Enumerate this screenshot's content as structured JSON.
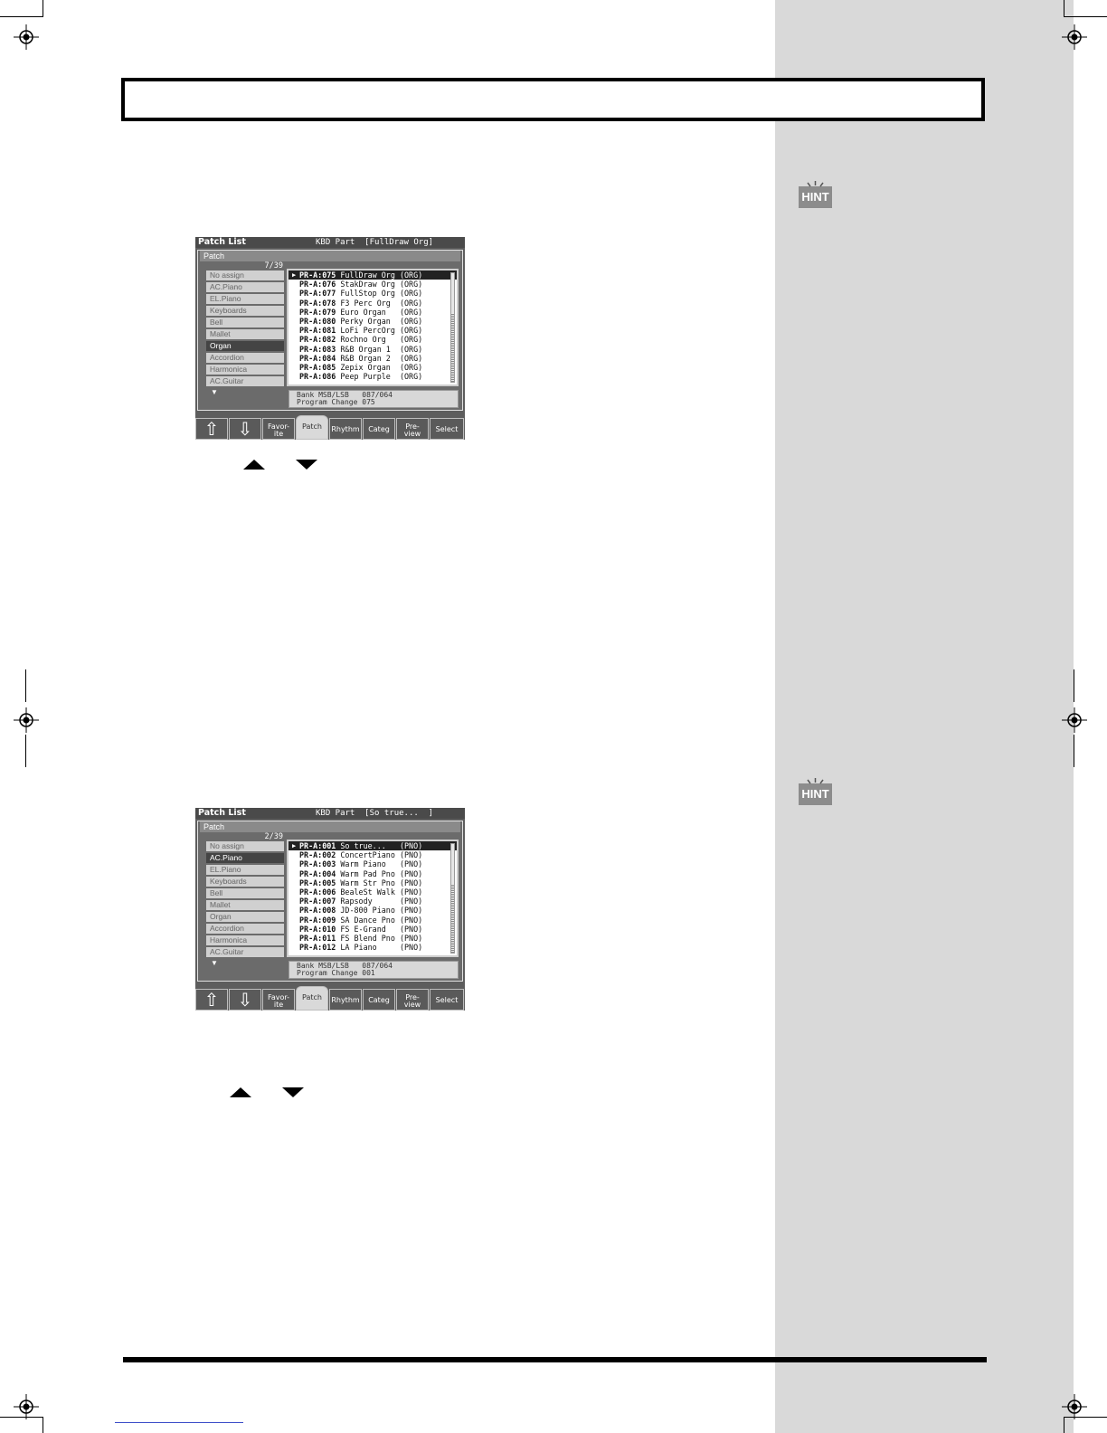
{
  "hint": {
    "label": "HINT"
  },
  "screens": [
    {
      "title": "Patch List",
      "part_label": "KBD Part  [FullDraw Org]",
      "tab_label": "Patch",
      "count": "7/39",
      "categories": [
        "No assign",
        "AC.Piano",
        "EL.Piano",
        "Keyboards",
        "Bell",
        "Mallet",
        "Organ",
        "Accordion",
        "Harmonica",
        "AC.Guitar"
      ],
      "selected_category": 6,
      "patches": [
        {
          "num": "PR-A:075",
          "name": "FullDraw Org",
          "cat": "(ORG)"
        },
        {
          "num": "PR-A:076",
          "name": "StakDraw Org",
          "cat": "(ORG)"
        },
        {
          "num": "PR-A:077",
          "name": "FullStop Org",
          "cat": "(ORG)"
        },
        {
          "num": "PR-A:078",
          "name": "F3 Perc Org ",
          "cat": "(ORG)"
        },
        {
          "num": "PR-A:079",
          "name": "Euro Organ  ",
          "cat": "(ORG)"
        },
        {
          "num": "PR-A:080",
          "name": "Perky Organ ",
          "cat": "(ORG)"
        },
        {
          "num": "PR-A:081",
          "name": "LoFi PercOrg",
          "cat": "(ORG)"
        },
        {
          "num": "PR-A:082",
          "name": "Rochno Org  ",
          "cat": "(ORG)"
        },
        {
          "num": "PR-A:083",
          "name": "R&B Organ 1 ",
          "cat": "(ORG)"
        },
        {
          "num": "PR-A:084",
          "name": "R&B Organ 2 ",
          "cat": "(ORG)"
        },
        {
          "num": "PR-A:085",
          "name": "Zepix Organ ",
          "cat": "(ORG)"
        },
        {
          "num": "PR-A:086",
          "name": "Peep Purple ",
          "cat": "(ORG)"
        }
      ],
      "bank_line": "Bank MSB/LSB   087/064",
      "program_line": "Program Change 075",
      "buttons": [
        "Favor-\nite",
        "Patch",
        "Rhythm",
        "Categ",
        "Pre-\nview",
        "Select"
      ]
    },
    {
      "title": "Patch List",
      "part_label": "KBD Part  [So true...  ]",
      "tab_label": "Patch",
      "count": "2/39",
      "categories": [
        "No assign",
        "AC.Piano",
        "EL.Piano",
        "Keyboards",
        "Bell",
        "Mallet",
        "Organ",
        "Accordion",
        "Harmonica",
        "AC.Guitar"
      ],
      "selected_category": 1,
      "patches": [
        {
          "num": "PR-A:001",
          "name": "So true...  ",
          "cat": "(PNO)"
        },
        {
          "num": "PR-A:002",
          "name": "ConcertPiano",
          "cat": "(PNO)"
        },
        {
          "num": "PR-A:003",
          "name": "Warm Piano  ",
          "cat": "(PNO)"
        },
        {
          "num": "PR-A:004",
          "name": "Warm Pad Pno",
          "cat": "(PNO)"
        },
        {
          "num": "PR-A:005",
          "name": "Warm Str Pno",
          "cat": "(PNO)"
        },
        {
          "num": "PR-A:006",
          "name": "BealeSt Walk",
          "cat": "(PNO)"
        },
        {
          "num": "PR-A:007",
          "name": "Rapsody     ",
          "cat": "(PNO)"
        },
        {
          "num": "PR-A:008",
          "name": "JD-800 Piano",
          "cat": "(PNO)"
        },
        {
          "num": "PR-A:009",
          "name": "SA Dance Pno",
          "cat": "(PNO)"
        },
        {
          "num": "PR-A:010",
          "name": "FS E-Grand  ",
          "cat": "(PNO)"
        },
        {
          "num": "PR-A:011",
          "name": "FS Blend Pno",
          "cat": "(PNO)"
        },
        {
          "num": "PR-A:012",
          "name": "LA Piano    ",
          "cat": "(PNO)"
        }
      ],
      "bank_line": "Bank MSB/LSB   087/064",
      "program_line": "Program Change 001",
      "buttons": [
        "Favor-\nite",
        "Patch",
        "Rhythm",
        "Categ",
        "Pre-\nview",
        "Select"
      ]
    }
  ]
}
